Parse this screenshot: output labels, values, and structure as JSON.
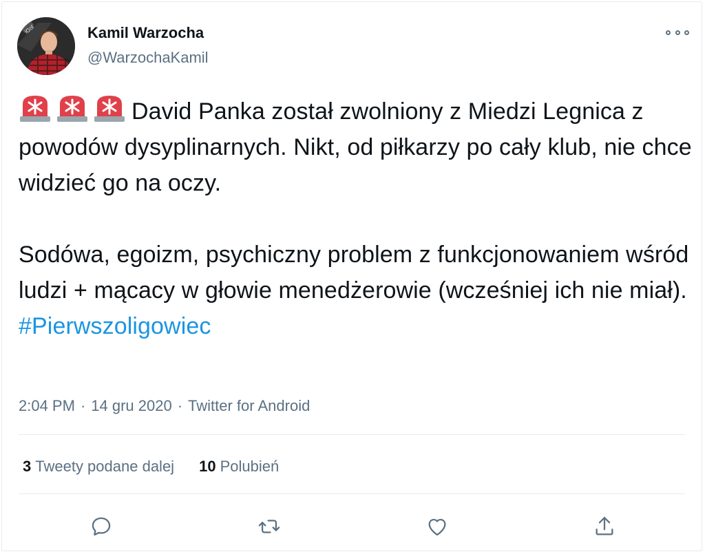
{
  "author": {
    "display_name": "Kamil Warzocha",
    "handle": "@WarzochaKamil",
    "avatar_badge": "iGol"
  },
  "tweet": {
    "emoji": [
      "police-light-emoji",
      "police-light-emoji",
      "police-light-emoji"
    ],
    "line1": "David Panka został zwolniony z Miedzi Legnica z powodów dysyplinarnych. Nikt, od piłkarzy po cały klub, nie chce widzieć go na oczy.",
    "line2": "Sodówa, egoizm, psychiczny problem z funkcjonowaniem wśród ludzi + mącacy w głowie menedżerowie (wcześniej ich nie miał).",
    "hashtag": "#Pierwszoligowiec"
  },
  "meta": {
    "time": "2:04 PM",
    "separator": "·",
    "date": "14 gru 2020",
    "source": "Twitter for Android"
  },
  "stats": {
    "retweets_count": "3",
    "retweets_label": "Tweety podane dalej",
    "likes_count": "10",
    "likes_label": "Polubień"
  },
  "icons": {
    "more": "more-icon",
    "reply": "reply-icon",
    "retweet": "retweet-icon",
    "like": "heart-icon",
    "share": "share-icon"
  },
  "colors": {
    "text": "#0f1419",
    "secondary": "#5b7083",
    "link": "#1b95e0",
    "siren": "#e0404a"
  }
}
